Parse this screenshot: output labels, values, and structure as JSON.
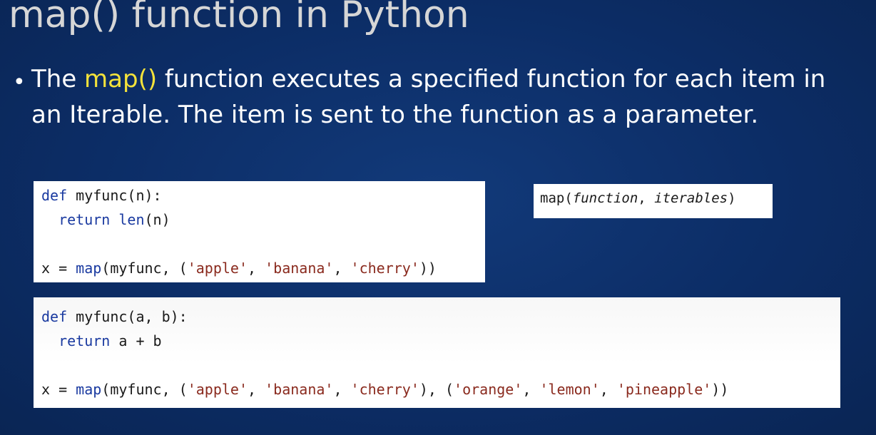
{
  "slide": {
    "title": "map() function in Python",
    "bullet": {
      "prefix": "The ",
      "highlight": "map()",
      "suffix": " function executes a specified function for each item in an Iterable. The item is sent to the function as a parameter."
    }
  },
  "syntax": {
    "prefix": "map(",
    "arg1": "function",
    "sep": ", ",
    "arg2": "iterables",
    "suffix": ")"
  },
  "code1": {
    "l1_kw": "def",
    "l1_rest": " myfunc(n):",
    "l2_indent": "  ",
    "l2_kw": "return",
    "l2_sp": " ",
    "l2_kw2": "len",
    "l2_rest": "(n)",
    "l3_pre": "x = ",
    "l3_kw": "map",
    "l3_mid": "(myfunc, (",
    "s1": "'apple'",
    "c1": ", ",
    "s2": "'banana'",
    "c2": ", ",
    "s3": "'cherry'",
    "l3_end": "))"
  },
  "code2": {
    "l1_kw": "def",
    "l1_rest": " myfunc(a, b):",
    "l2_indent": "  ",
    "l2_kw": "return",
    "l2_rest": " a + b",
    "l3_pre": "x = ",
    "l3_kw": "map",
    "l3_mid": "(myfunc, (",
    "s1": "'apple'",
    "c1": ", ",
    "s2": "'banana'",
    "c2": ", ",
    "s3": "'cherry'",
    "m2": "), (",
    "s4": "'orange'",
    "c4": ", ",
    "s5": "'lemon'",
    "c5": ", ",
    "s6": "'pineapple'",
    "l3_end": "))"
  }
}
